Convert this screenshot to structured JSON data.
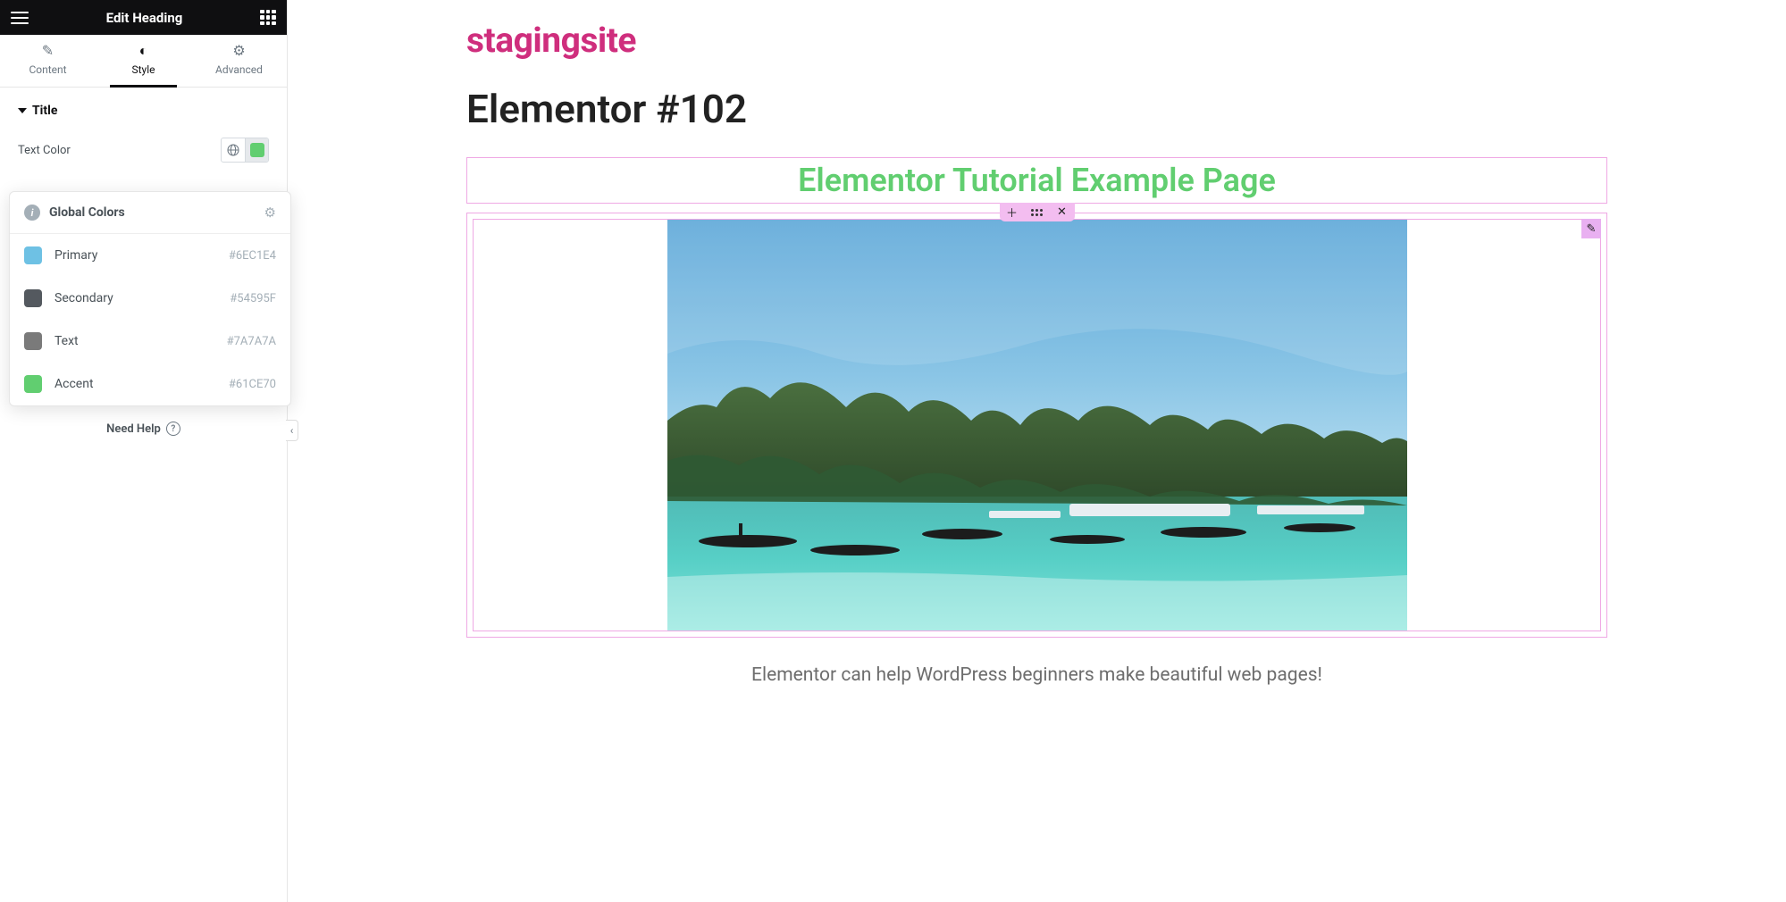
{
  "sidebar": {
    "title": "Edit Heading",
    "tabs": {
      "content": "Content",
      "style": "Style",
      "advanced": "Advanced",
      "active": "style"
    },
    "section": "Title",
    "row": {
      "label": "Text Color",
      "swatch": "#61ce70"
    },
    "popover": {
      "title": "Global Colors",
      "items": [
        {
          "label": "Primary",
          "hex": "#6EC1E4"
        },
        {
          "label": "Secondary",
          "hex": "#54595F"
        },
        {
          "label": "Text",
          "hex": "#7A7A7A"
        },
        {
          "label": "Accent",
          "hex": "#61CE70"
        }
      ]
    },
    "help": "Need Help"
  },
  "canvas": {
    "site_title": "stagingsite",
    "page_title": "Elementor #102",
    "heading": "Elementor Tutorial Example Page",
    "caption": "Elementor can help WordPress beginners make beautiful web pages!"
  },
  "colors": {
    "accent": "#61ce70",
    "brand": "#cf2e7d",
    "outline": "#efa8e4"
  }
}
